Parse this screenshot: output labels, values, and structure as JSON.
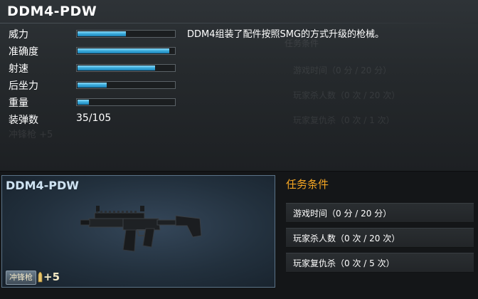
{
  "weapon": {
    "name": "DDM4-PDW",
    "description": "DDM4组装了配件按照SMG的方式升级的枪械。"
  },
  "stats": [
    {
      "label": "威力",
      "fill": 0.5
    },
    {
      "label": "准确度",
      "fill": 0.95
    },
    {
      "label": "射速",
      "fill": 0.8
    },
    {
      "label": "后坐力",
      "fill": 0.3
    },
    {
      "label": "重量",
      "fill": 0.12
    }
  ],
  "ammo": {
    "label": "装弹数",
    "value": "35/105"
  },
  "card": {
    "name": "DDM4-PDW",
    "tag": "冲锋枪",
    "plus": "+5"
  },
  "mission": {
    "title": "任务条件",
    "items": [
      "游戏时间（0 分 / 20 分）",
      "玩家杀人数（0 次 / 20 次）",
      "玩家复仇杀（0 次 / 5 次）"
    ]
  },
  "colors": {
    "accent_orange": "#f5a623",
    "bar_blue": "#3fb0df"
  }
}
